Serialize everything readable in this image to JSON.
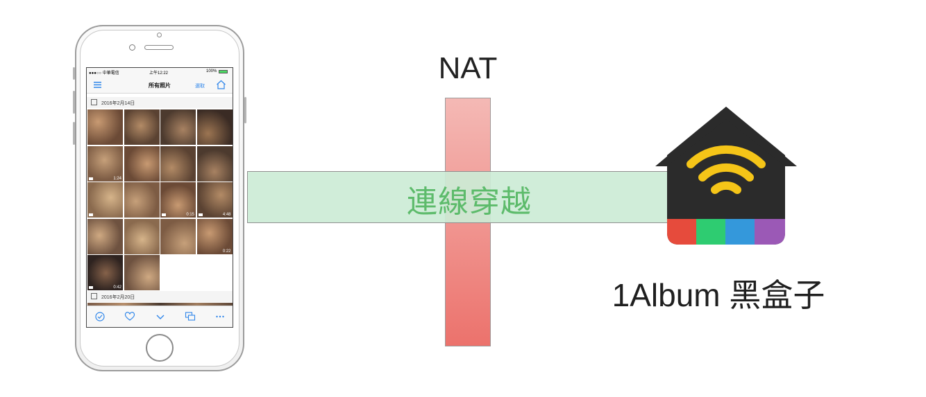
{
  "phone": {
    "status_bar": {
      "carrier": "●●●○○ 中華電信",
      "time": "上午12:22",
      "battery": "100%"
    },
    "nav": {
      "title": "所有照片",
      "select_label": "選取"
    },
    "sections": [
      {
        "date": "2016年2月14日",
        "thumbnails": [
          {
            "duration": ""
          },
          {
            "duration": ""
          },
          {
            "duration": ""
          },
          {
            "duration": ""
          },
          {
            "duration": "1:24",
            "video": true
          },
          {
            "duration": ""
          },
          {
            "duration": ""
          },
          {
            "duration": ""
          },
          {
            "duration": "",
            "video": true
          },
          {
            "duration": ""
          },
          {
            "duration": "0:15",
            "video": true
          },
          {
            "duration": "4:48",
            "video": true
          },
          {
            "duration": ""
          },
          {
            "duration": ""
          },
          {
            "duration": ""
          },
          {
            "duration": "0:22"
          },
          {
            "duration": "0:42",
            "video": true
          },
          {
            "duration": ""
          }
        ]
      },
      {
        "date": "2016年2月20日"
      }
    ],
    "toolbar_icons": [
      "check-circle-icon",
      "heart-icon",
      "chevron-down-icon",
      "chat-bubbles-icon",
      "more-icon"
    ]
  },
  "diagram": {
    "nat_label": "NAT",
    "tunnel_label": "連線穿越",
    "box_label": "1Album 黑盒子"
  },
  "colors": {
    "tunnel_fill": "#cdebd6",
    "tunnel_text": "#5dbb6b",
    "nat_top": "#f4b9b5",
    "nat_bottom": "#ec726c",
    "box_body": "#2b2b2b",
    "wifi": "#f5c518",
    "stripe_red": "#e64b3c",
    "stripe_green": "#2ecc71",
    "stripe_blue": "#3498db",
    "stripe_purple": "#9b59b6",
    "ios_blue": "#2f86ea"
  }
}
